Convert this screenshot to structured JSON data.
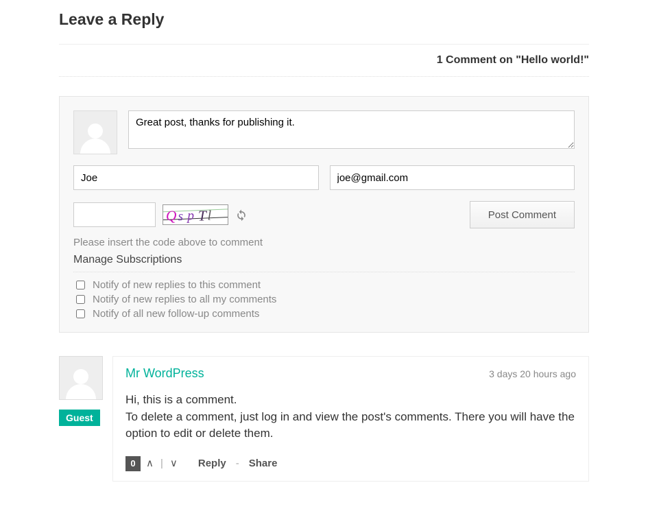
{
  "page_title": "Leave a Reply",
  "comment_count_text": "1 Comment on \"Hello world!\"",
  "form": {
    "comment_value": "Great post, thanks for publishing it.",
    "name_value": "Joe",
    "email_value": "joe@gmail.com",
    "captcha_value": "",
    "captcha_text": "QspTl",
    "post_button": "Post Comment",
    "help_text": "Please insert the code above to comment",
    "manage_sub": "Manage Subscriptions",
    "sub_options": [
      "Notify of new replies to this comment",
      "Notify of new replies to all my comments",
      "Notify of all new follow-up comments"
    ]
  },
  "comment": {
    "author": "Mr WordPress",
    "time": "3 days 20 hours ago",
    "badge": "Guest",
    "body_line1": "Hi, this is a comment.",
    "body_line2": "To delete a comment, just log in and view the post's comments. There you will have the option to edit or delete them.",
    "votes": "0",
    "reply": "Reply",
    "share": "Share"
  }
}
